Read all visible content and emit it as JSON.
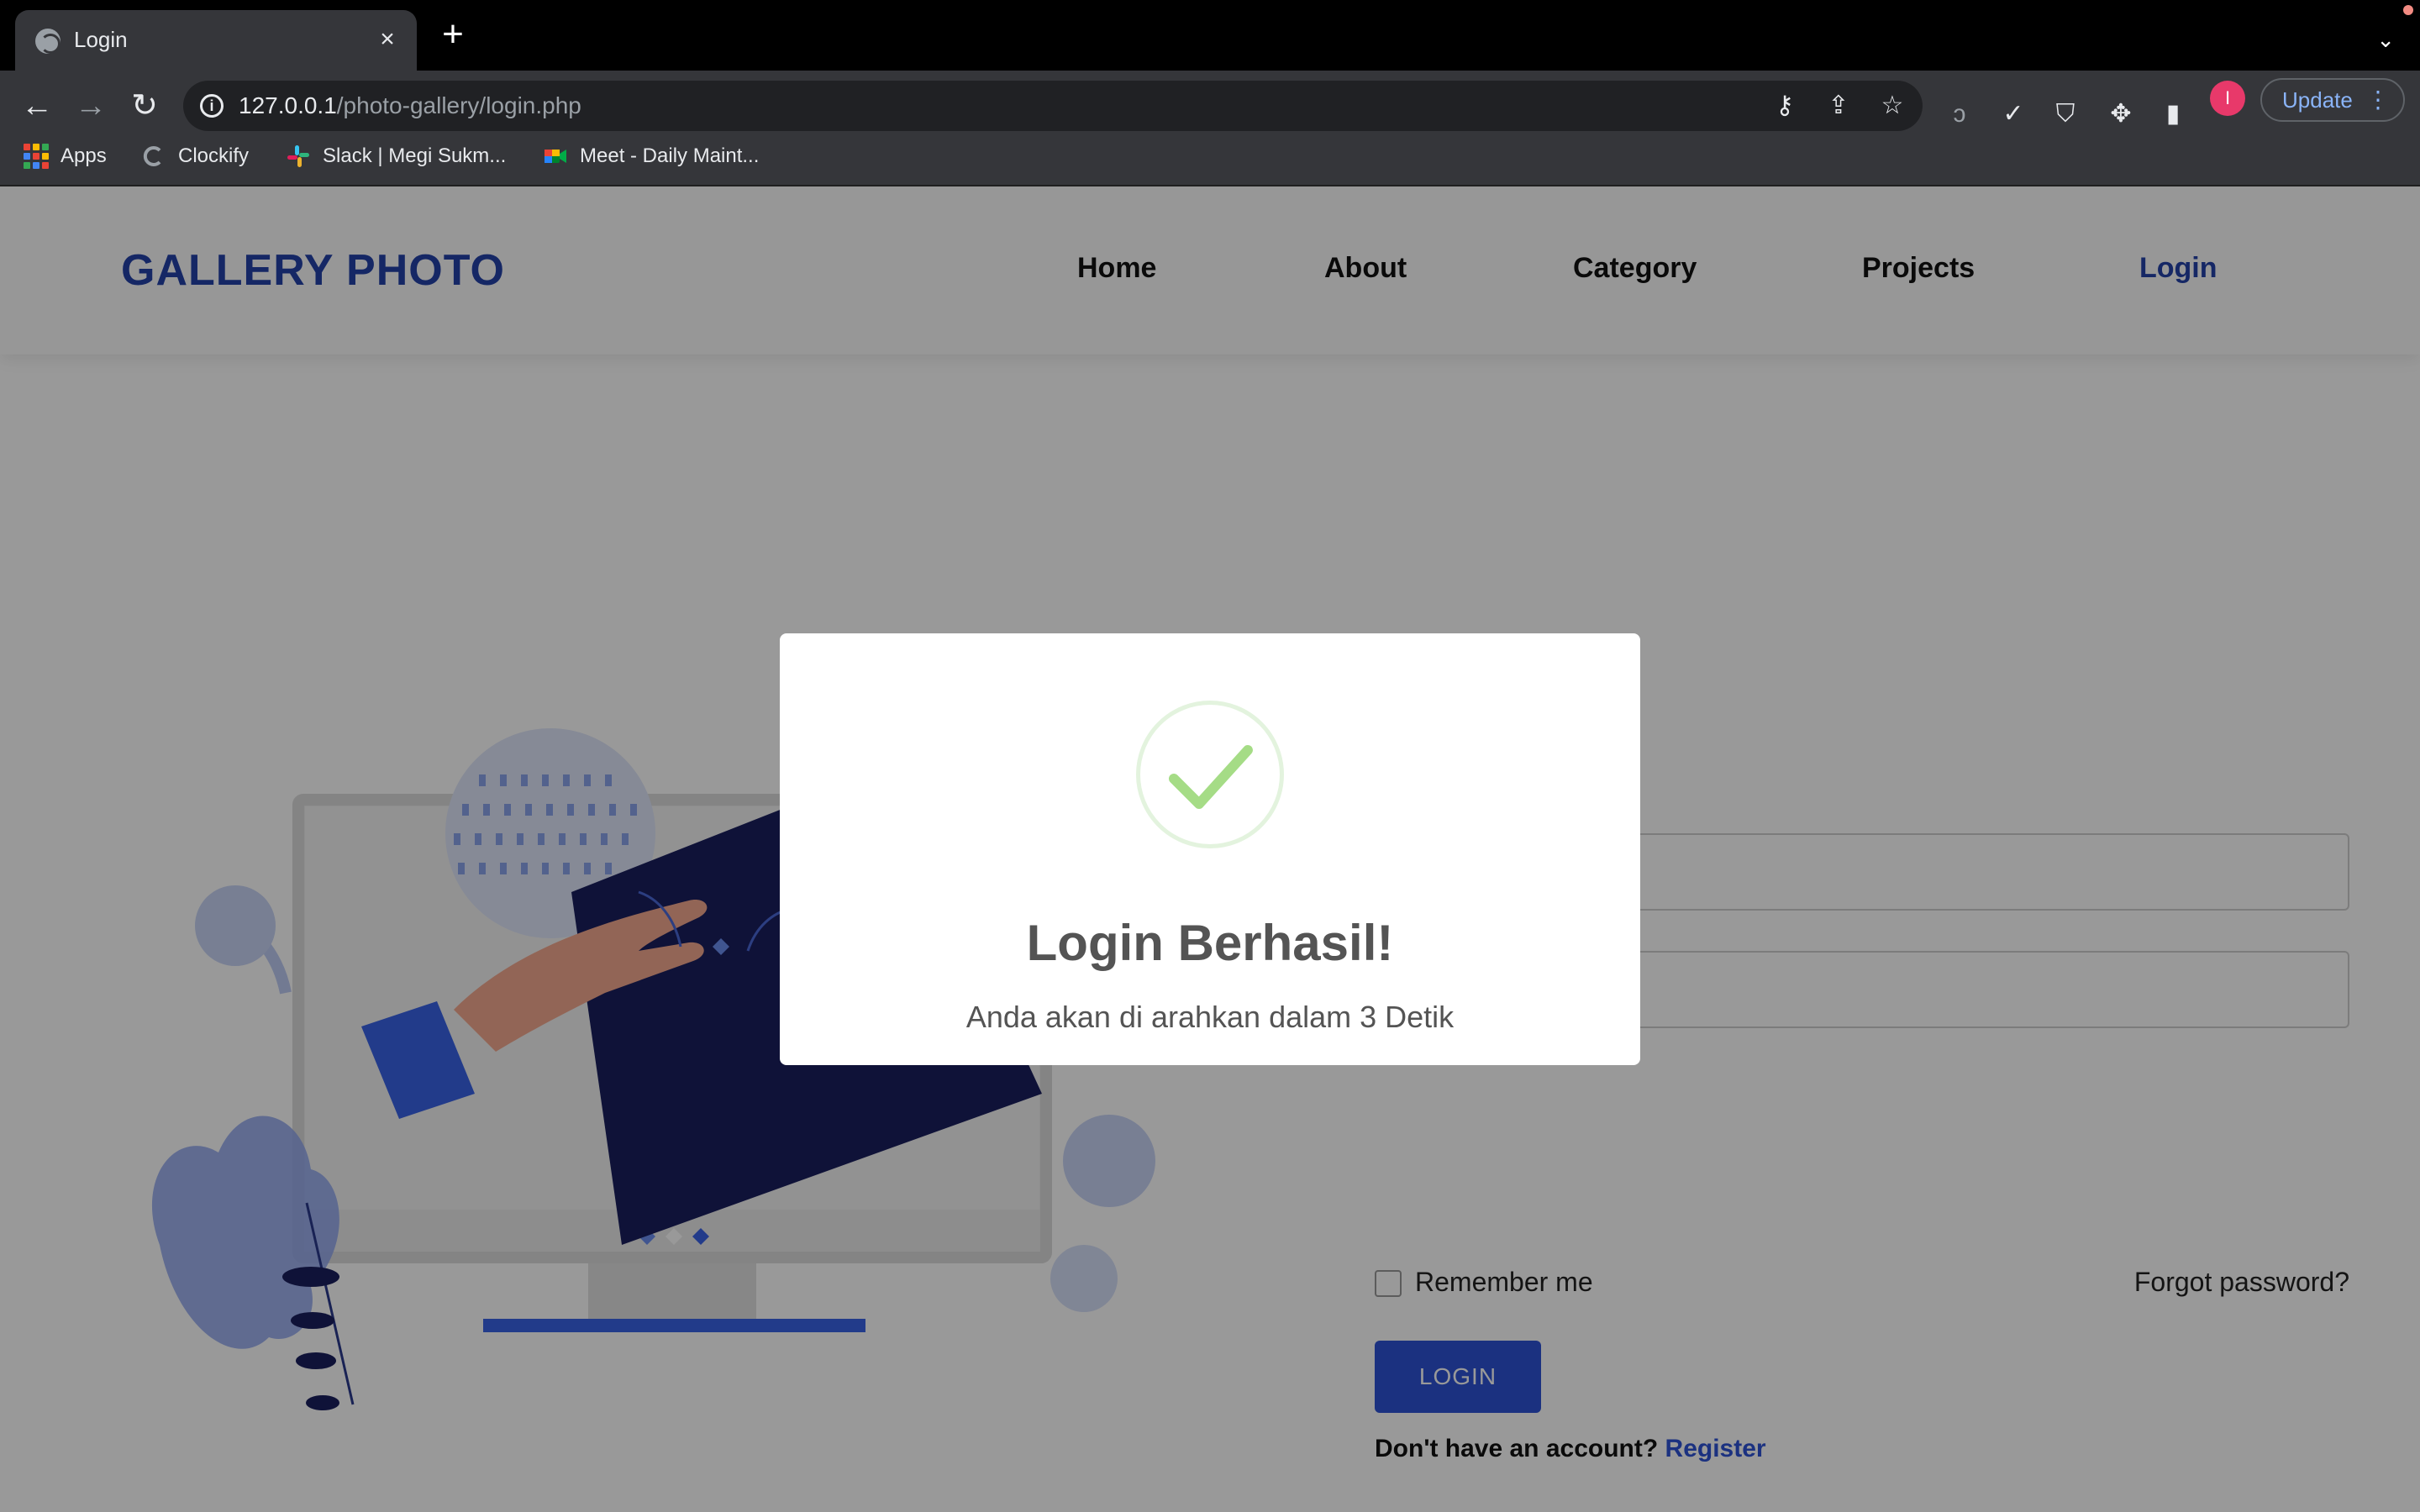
{
  "browser": {
    "tab_title": "Login",
    "url_host": "127.0.0.1",
    "url_path": "/photo-gallery/login.php",
    "update_label": "Update",
    "profile_initial": "I",
    "bookmarks": [
      {
        "label": "Apps",
        "icon": "apps-grid-icon"
      },
      {
        "label": "Clockify",
        "icon": "clockify-icon"
      },
      {
        "label": "Slack | Megi Sukm...",
        "icon": "slack-icon"
      },
      {
        "label": "Meet - Daily Maint...",
        "icon": "google-meet-icon"
      }
    ]
  },
  "site": {
    "logo": "GALLERY PHOTO",
    "nav": [
      {
        "label": "Home",
        "active": false
      },
      {
        "label": "About",
        "active": false
      },
      {
        "label": "Category",
        "active": false
      },
      {
        "label": "Projects",
        "active": false
      },
      {
        "label": "Login",
        "active": true
      }
    ]
  },
  "login_form": {
    "remember_label": "Remember me",
    "forgot_label": "Forgot password?",
    "login_button": "LOGIN",
    "no_account_text": "Don't have an account?",
    "register_link": "Register"
  },
  "modal": {
    "title": "Login Berhasil!",
    "message": "Anda akan di arahkan dalam 3 Detik",
    "icon": "success-check-icon"
  },
  "colors": {
    "brand": "#2342a8",
    "button": "#2d53d6",
    "success": "#a5dc86",
    "overlay": "rgba(0,0,0,0.4)"
  }
}
